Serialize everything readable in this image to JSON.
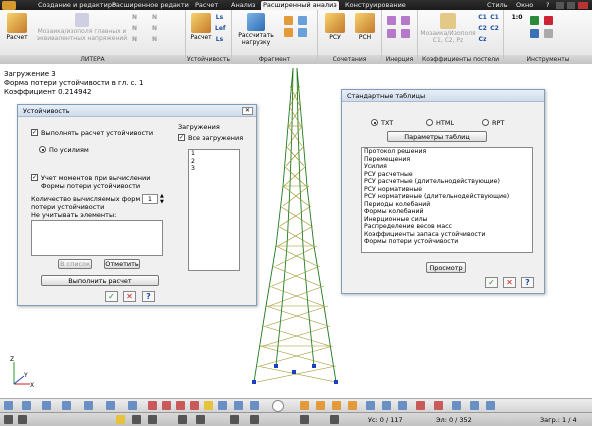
{
  "menu": {
    "tabs": [
      "Создание и редактиро",
      "Расширенное редакти",
      "Расчет",
      "Анализ",
      "Расширенный анализ",
      "Конструирование"
    ],
    "active_index": 4,
    "right": [
      "Стиль",
      "Окно",
      "?"
    ]
  },
  "ribbon": {
    "groups": [
      {
        "caption": "ЛИТЕРА",
        "buttons": [
          "Расчет",
          "Мозаика/изополя главных и эквивалентных напряжений"
        ]
      },
      {
        "caption": "Устойчивость",
        "buttons": [
          "Расчет"
        ]
      },
      {
        "caption": "Фрагмент",
        "buttons": [
          "Рассчитать нагрузку"
        ]
      },
      {
        "caption": "Сочетания",
        "buttons": [
          "РСУ",
          "РСН"
        ]
      },
      {
        "caption": "Инерция",
        "buttons": []
      },
      {
        "caption": "Коэффициенты постели",
        "buttons": [
          "Мозаика/Изополя C1, C2, Pz"
        ]
      },
      {
        "caption": "Инструменты",
        "buttons": []
      }
    ],
    "small_labels": {
      "c1": "C1",
      "c2": "C2",
      "c_z": "Cz",
      "n": "N",
      "ls": "Ls",
      "lef": "Lef",
      "one": "1:0"
    }
  },
  "info": {
    "line1": "Загружение  3",
    "line2": "Форма потери устойчивости в гл. с.  1",
    "line3": "Коэффициент   0.214942"
  },
  "stability": {
    "title": "Устойчивость",
    "check_perform": "Выполнять расчет устойчивости",
    "radio_forces": "По усилиям",
    "check_moments_l1": "Учет моментов при вычислении",
    "check_moments_l2": "Формы потери устойчивости",
    "count_label_l1": "Количество вычисляемых форм",
    "count_label_l2": "потери устойчивости",
    "count_value": "1",
    "ignore_label": "Не учитывать элементы:",
    "to_list": "В список",
    "mark": "Отметить",
    "loads_title": "Загружения",
    "all_loads": "Все загружения",
    "loads": [
      "1",
      "2",
      "3"
    ],
    "run": "Выполнить расчет"
  },
  "tables": {
    "title": "Стандартные таблицы",
    "formats": [
      "TXT",
      "HTML",
      "RPT"
    ],
    "params": "Параметры таблиц",
    "items": [
      "Протокол решения",
      "Перемещения",
      "Усилия",
      "РСУ расчетные",
      "РСУ расчетные (длительнодействующие)",
      "РСУ нормативные",
      "РСУ нормативные (длительнодействующие)",
      "Периоды колебаний",
      "Формы колебаний",
      "Инерционные силы",
      "Распределение весов масс",
      "Коэффициенты запаса устойчивости",
      "Формы потери устойчивости"
    ],
    "preview": "Просмотр"
  },
  "status": {
    "left": "Ус: 0 / 117",
    "mid": "Эл: 0 / 352",
    "right": "Загр.: 1 / 4"
  },
  "axes": {
    "x": "X",
    "y": "Y",
    "z": "Z"
  }
}
